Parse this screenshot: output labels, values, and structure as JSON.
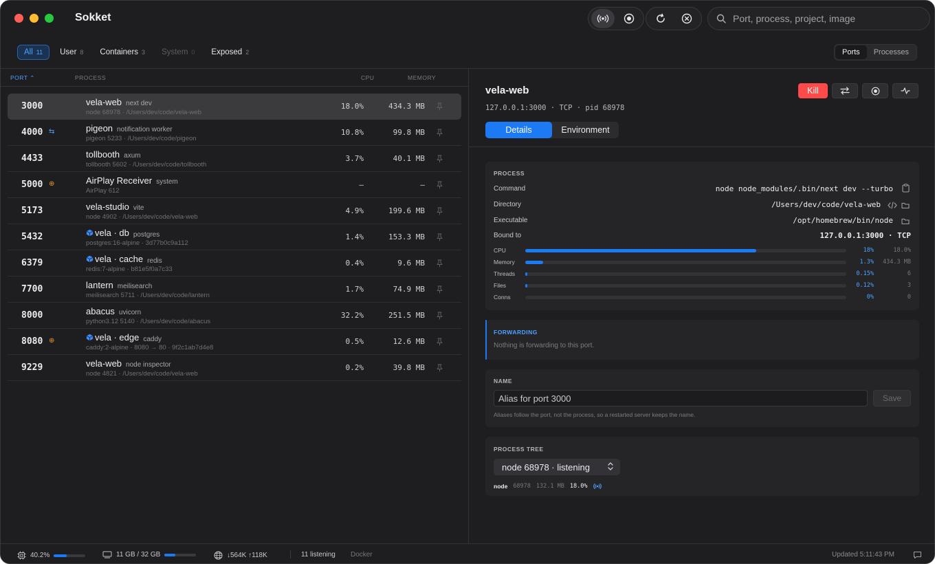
{
  "app": {
    "title": "Sokket"
  },
  "search": {
    "placeholder": "Port, process, project, image"
  },
  "filters": [
    {
      "label": "All",
      "count": "11"
    },
    {
      "label": "User",
      "count": "8"
    },
    {
      "label": "Containers",
      "count": "3"
    },
    {
      "label": "System",
      "count": "0"
    },
    {
      "label": "Exposed",
      "count": "2"
    }
  ],
  "view_toggle": {
    "ports": "Ports",
    "processes": "Processes"
  },
  "columns": {
    "port": "PORT",
    "process": "PROCESS",
    "cpu": "CPU",
    "memory": "MEMORY"
  },
  "rows": [
    {
      "port": "3000",
      "name": "vela-web",
      "sub": "next dev",
      "meta": "node 68978 · /Users/dev/code/vela-web",
      "cpu": "18.0%",
      "mem": "434.3 MB"
    },
    {
      "port": "4000",
      "name": "pigeon",
      "sub": "notification worker",
      "meta": "pigeon 5233 · /Users/dev/code/pigeon",
      "cpu": "10.8%",
      "mem": "99.8 MB"
    },
    {
      "port": "4433",
      "name": "tollbooth",
      "sub": "axum",
      "meta": "tollbooth 5602 · /Users/dev/code/tollbooth",
      "cpu": "3.7%",
      "mem": "40.1 MB"
    },
    {
      "port": "5000",
      "name": "AirPlay Receiver",
      "sub": "system",
      "meta": "AirPlay 612",
      "cpu": "—",
      "mem": "—"
    },
    {
      "port": "5173",
      "name": "vela-studio",
      "sub": "vite",
      "meta": "node 4902 · /Users/dev/code/vela-web",
      "cpu": "4.9%",
      "mem": "199.6 MB"
    },
    {
      "port": "5432",
      "name": "vela · db",
      "sub": "postgres",
      "meta": "postgres:16-alpine · 3d77b0c9a112",
      "cpu": "1.4%",
      "mem": "153.3 MB"
    },
    {
      "port": "6379",
      "name": "vela · cache",
      "sub": "redis",
      "meta": "redis:7-alpine · b81e5f0a7c33",
      "cpu": "0.4%",
      "mem": "9.6 MB"
    },
    {
      "port": "7700",
      "name": "lantern",
      "sub": "meilisearch",
      "meta": "meilisearch 5711 · /Users/dev/code/lantern",
      "cpu": "1.7%",
      "mem": "74.9 MB"
    },
    {
      "port": "8000",
      "name": "abacus",
      "sub": "uvicorn",
      "meta": "python3.12 5140 · /Users/dev/code/abacus",
      "cpu": "32.2%",
      "mem": "251.5 MB"
    },
    {
      "port": "8080",
      "name": "vela · edge",
      "sub": "caddy",
      "meta": "caddy:2-alpine · 8080 → 80 · 9f2c1ab7d4e8",
      "cpu": "0.5%",
      "mem": "12.6 MB"
    },
    {
      "port": "9229",
      "name": "vela-web",
      "sub": "node inspector",
      "meta": "node 4821 · /Users/dev/code/vela-web",
      "cpu": "0.2%",
      "mem": "39.8 MB"
    }
  ],
  "detail": {
    "title": "vela-web",
    "subtitle": "127.0.0.1:3000 · TCP · pid 68978",
    "kill_label": "Kill",
    "tabs": [
      "Details",
      "Environment"
    ],
    "process_section": {
      "title": "PROCESS",
      "command_label": "Command",
      "command": "node node_modules/.bin/next dev --turbo",
      "directory_label": "Directory",
      "directory": "/Users/dev/code/vela-web",
      "executable_label": "Executable",
      "executable": "/opt/homebrew/bin/node",
      "bound_label": "Bound to",
      "bound": "127.0.0.1:3000 · TCP",
      "metrics": [
        {
          "label": "CPU",
          "pct": "18%",
          "value": "18.0%",
          "fill": 0.72
        },
        {
          "label": "Memory",
          "pct": "1.3%",
          "value": "434.3 MB",
          "fill": 0.055
        },
        {
          "label": "Threads",
          "pct": "0.15%",
          "value": "6",
          "fill": 0.006
        },
        {
          "label": "Files",
          "pct": "0.12%",
          "value": "3",
          "fill": 0.005
        },
        {
          "label": "Conns",
          "pct": "0%",
          "value": "0",
          "fill": 0
        }
      ]
    },
    "forwarding": {
      "title": "FORWARDING",
      "text": "Nothing is forwarding to this port."
    },
    "name_section": {
      "title": "NAME",
      "placeholder": "Alias for port 3000",
      "save": "Save",
      "help": "Aliases follow the port, not the process, so a restarted server keeps the name."
    },
    "tree": {
      "title": "PROCESS TREE",
      "selected": "node 68978 · listening",
      "node_name": "node",
      "node_pid": "68978",
      "node_mem": "132.1 MB",
      "node_cpu": "18.0%"
    }
  },
  "status": {
    "cpu": "40.2%",
    "cpu_fill": 0.402,
    "memory": "11 GB / 32 GB",
    "memory_fill": 0.34,
    "network": "↓564K ↑118K",
    "listening": "11 listening",
    "docker": "Docker",
    "updated": "Updated 5:11:43 PM"
  }
}
